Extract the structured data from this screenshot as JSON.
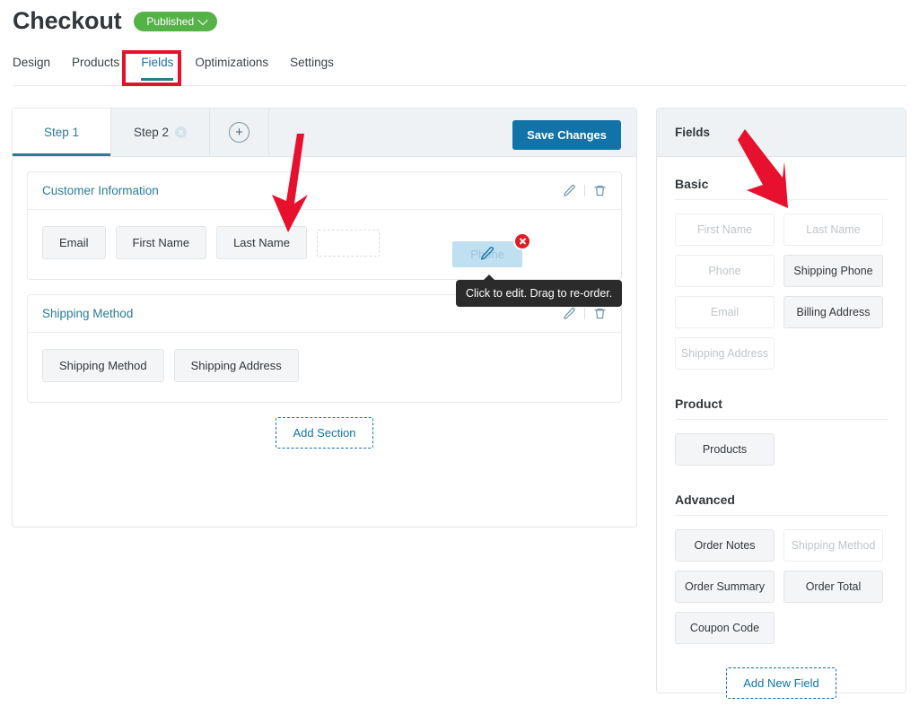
{
  "header": {
    "title": "Checkout",
    "status_label": "Published",
    "status_color": "#55b247"
  },
  "top_nav": {
    "tabs": [
      {
        "label": "Design",
        "active": false
      },
      {
        "label": "Products",
        "active": false
      },
      {
        "label": "Fields",
        "active": true
      },
      {
        "label": "Optimizations",
        "active": false
      },
      {
        "label": "Settings",
        "active": false
      }
    ],
    "accent_color": "#2c7c94",
    "annotation_color": "#e8112d"
  },
  "editor": {
    "steps": [
      {
        "label": "Step 1",
        "active": true,
        "closable": false
      },
      {
        "label": "Step 2",
        "active": false,
        "closable": true
      }
    ],
    "add_step_icon": "plus-icon",
    "save_label": "Save Changes",
    "save_color": "#1273a8",
    "sections": [
      {
        "title": "Customer Information",
        "edit_icon": "pencil-icon",
        "delete_icon": "trash-icon",
        "fields": [
          "Email",
          "First Name",
          "Last Name"
        ],
        "has_placeholder": true
      },
      {
        "title": "Shipping Method",
        "edit_icon": "pencil-icon",
        "delete_icon": "trash-icon",
        "fields": [
          "Shipping Method",
          "Shipping Address"
        ],
        "has_placeholder": false
      }
    ],
    "add_section_label": "Add Section"
  },
  "drag": {
    "ghost_label": "Phone",
    "ghost_icon": "pencil-icon",
    "delete_icon": "close-icon",
    "delete_color": "#e01b24",
    "tooltip_text": "Click to edit. Drag to re-order."
  },
  "fields_panel": {
    "title": "Fields",
    "groups": [
      {
        "name": "Basic",
        "chips": [
          {
            "label": "First Name",
            "disabled": true
          },
          {
            "label": "Last Name",
            "disabled": true
          },
          {
            "label": "Phone",
            "disabled": true
          },
          {
            "label": "Shipping Phone",
            "disabled": false
          },
          {
            "label": "Email",
            "disabled": true
          },
          {
            "label": "Billing Address",
            "disabled": false
          },
          {
            "label": "Shipping Address",
            "disabled": true
          }
        ]
      },
      {
        "name": "Product",
        "chips": [
          {
            "label": "Products",
            "disabled": false
          }
        ]
      },
      {
        "name": "Advanced",
        "chips": [
          {
            "label": "Order Notes",
            "disabled": false
          },
          {
            "label": "Shipping Method",
            "disabled": true
          },
          {
            "label": "Order Summary",
            "disabled": false
          },
          {
            "label": "Order Total",
            "disabled": false
          },
          {
            "label": "Coupon Code",
            "disabled": false
          }
        ]
      }
    ],
    "add_field_label": "Add New Field"
  }
}
